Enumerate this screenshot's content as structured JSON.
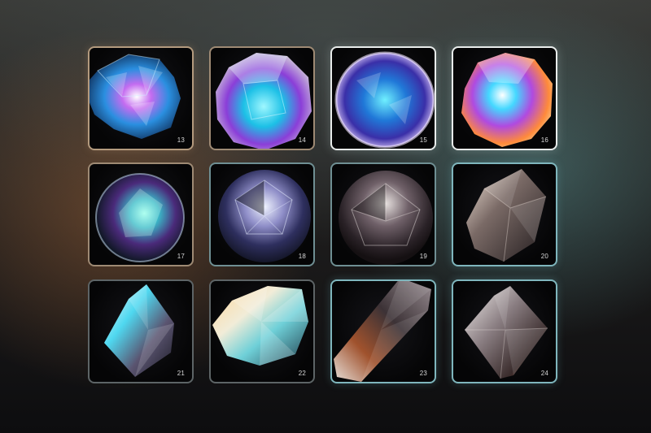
{
  "gallery": {
    "tiles": [
      {
        "label": "13",
        "gem": "faceted-galaxy-crystal-icon"
      },
      {
        "label": "14",
        "gem": "round-galaxy-crystal-icon"
      },
      {
        "label": "15",
        "gem": "round-cosmic-crystal-icon"
      },
      {
        "label": "16",
        "gem": "round-nebula-crystal-icon"
      },
      {
        "label": "17",
        "gem": "crystal-sphere-icon"
      },
      {
        "label": "18",
        "gem": "faceted-sphere-icon"
      },
      {
        "label": "19",
        "gem": "smoky-sphere-icon"
      },
      {
        "label": "20",
        "gem": "smoky-shard-icon"
      },
      {
        "label": "21",
        "gem": "diamond-crystal-icon"
      },
      {
        "label": "22",
        "gem": "golden-crystal-icon"
      },
      {
        "label": "23",
        "gem": "elongated-smoky-crystal-icon"
      },
      {
        "label": "24",
        "gem": "smoky-diamond-crystal-icon"
      }
    ]
  }
}
